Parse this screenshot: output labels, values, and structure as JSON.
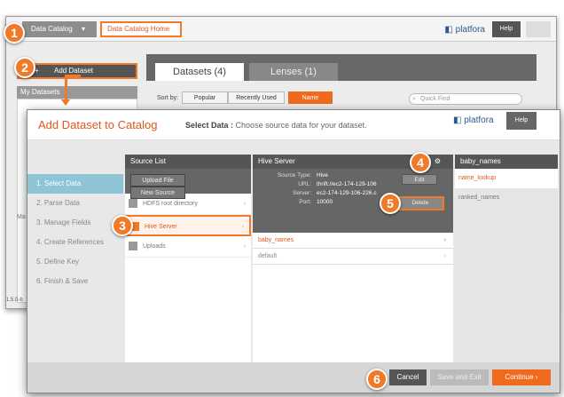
{
  "background": {
    "data_catalog": "Data Catalog",
    "home": "Data Catalog Home",
    "logo": "platfora",
    "help": "Help",
    "add_dataset": "Add Dataset",
    "my_datasets": "My Datasets",
    "tab_datasets": "Datasets (4)",
    "tab_lenses": "Lenses (1)",
    "sort_by": "Sort by:",
    "sort_popular": "Popular",
    "sort_recent": "Recently Used",
    "sort_name": "Name",
    "quick_find": "Quick Find",
    "side_ma": "Ma",
    "version": "1.5.0-b"
  },
  "modal": {
    "title": "Add Dataset to Catalog",
    "sub_label": "Select Data :",
    "sub_text": "Choose source data for your dataset.",
    "logo": "platfora",
    "help": "Help"
  },
  "steps": [
    "1. Select Data",
    "2. Parse Data",
    "3. Manage Fields",
    "4. Create References",
    "5. Define Key",
    "6. Finish & Save"
  ],
  "source_list": {
    "header": "Source List",
    "upload_file": "Upload File",
    "new_source": "New Source",
    "items": [
      "HDFS root directory",
      "Hive Server",
      "Uploads"
    ]
  },
  "hive": {
    "header": "Hive Server",
    "labels": [
      "Source Type:",
      "URL:",
      "Server:",
      "Port:"
    ],
    "values": [
      "Hive",
      "thrift://ec2-174-129-106",
      "ec2-174-129-106-226.c",
      "10000"
    ],
    "edit": "Edit",
    "delete": "Delete",
    "rows": [
      "baby_names",
      "default"
    ]
  },
  "baby": {
    "header": "baby_names",
    "rows": [
      "name_lookup",
      "ranked_names"
    ]
  },
  "footer": {
    "cancel": "Cancel",
    "save_exit": "Save and Exit",
    "continue": "Continue"
  },
  "badges": [
    "1",
    "2",
    "3",
    "4",
    "5",
    "6"
  ],
  "colors": {
    "accent": "#f07a28",
    "step_active": "#8fc4d6"
  }
}
